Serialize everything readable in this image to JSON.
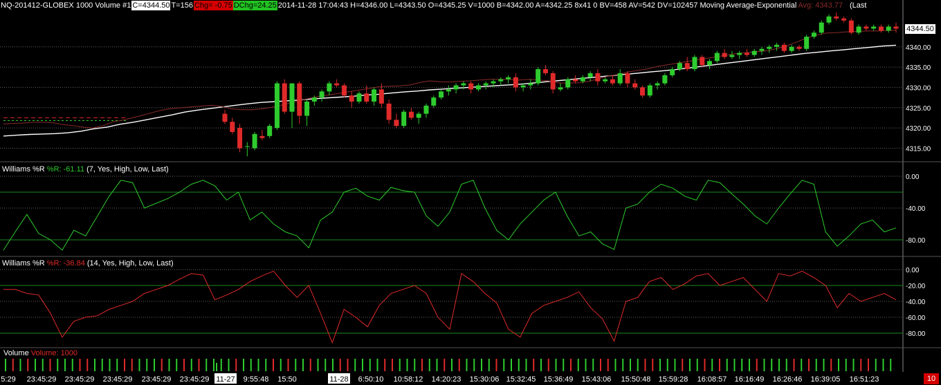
{
  "header": {
    "symbol": "NQ-201412-GLOBEX  1000 Volume  #1",
    "close": "C=4344.50",
    "trades": "T=156",
    "chg": "Chg= -0.75",
    "dchg": "DChg=24.25",
    "info": "2014-11-28 17:04:43 H=4346.00 L=4343.50 O=4345.25 V=1000 B=4342.00 A=4342.25 8x41 0 BV=458 AV=542 DV=102457 Moving Average-Exponential",
    "avg": "Avg: 4343.77",
    "last": "(Last"
  },
  "panels": {
    "wr7": {
      "name": "Williams %R",
      "value": "%R: -61.11",
      "params": "(7, Yes, High, Low, Last)"
    },
    "wr14": {
      "name": "Williams %R",
      "value": "%R: -36.84",
      "params": "(14, Yes, High, Low, Last)"
    },
    "volume": {
      "name": "Volume",
      "value": "Volume: 1000"
    }
  },
  "price_tag": "4344.50",
  "corner_badge": "10",
  "colors": {
    "up": "#2ecc2e",
    "down": "#e02a2a",
    "ma_slow": "#ffffff",
    "ma_fast": "#8a2b2b",
    "grid": "#666666"
  },
  "chart_data": [
    {
      "type": "candlestick",
      "title": "NQ-201412-GLOBEX 1000 Volume",
      "ylim": [
        4312,
        4349
      ],
      "y_ticks": [
        "4340.00",
        "4335.00",
        "4330.00",
        "4325.00",
        "4320.00",
        "4315.00"
      ],
      "x_labels": [
        "5:29",
        "23:45:29",
        "23:45:29",
        "23:45:29",
        "23:45:29",
        "23:45:29",
        "11-27",
        "9:55:48",
        "15:50",
        "11-28",
        "6:50:10",
        "10:58:12",
        "14:20:23",
        "15:30:06",
        "15:32:45",
        "15:36:49",
        "15:43:06",
        "15:50:48",
        "15:59:28",
        "16:08:57",
        "16:16:49",
        "16:26:46",
        "16:39:05",
        "16:51:23"
      ],
      "date_boxes": [
        "11-27",
        "11-28"
      ],
      "candles": [
        {
          "o": 4323.5,
          "h": 4324.5,
          "l": 4321.0,
          "c": 4321.5
        },
        {
          "o": 4321.5,
          "h": 4322.5,
          "l": 4318.5,
          "c": 4319.0
        },
        {
          "o": 4320.0,
          "h": 4321.0,
          "l": 4314.0,
          "c": 4315.0
        },
        {
          "o": 4315.5,
          "h": 4316.5,
          "l": 4313.0,
          "c": 4315.5
        },
        {
          "o": 4315.0,
          "h": 4319.0,
          "l": 4314.5,
          "c": 4318.5
        },
        {
          "o": 4318.0,
          "h": 4319.5,
          "l": 4317.0,
          "c": 4317.5
        },
        {
          "o": 4318.0,
          "h": 4321.0,
          "l": 4317.5,
          "c": 4320.5
        },
        {
          "o": 4320.0,
          "h": 4331.5,
          "l": 4319.5,
          "c": 4331.0
        },
        {
          "o": 4331.0,
          "h": 4332.0,
          "l": 4323.5,
          "c": 4324.0
        },
        {
          "o": 4324.0,
          "h": 4331.0,
          "l": 4320.0,
          "c": 4331.0
        },
        {
          "o": 4331.0,
          "h": 4331.5,
          "l": 4321.0,
          "c": 4323.0
        },
        {
          "o": 4323.0,
          "h": 4327.0,
          "l": 4320.5,
          "c": 4326.5
        },
        {
          "o": 4326.5,
          "h": 4328.0,
          "l": 4325.5,
          "c": 4327.5
        },
        {
          "o": 4327.5,
          "h": 4329.5,
          "l": 4326.5,
          "c": 4329.0
        },
        {
          "o": 4329.0,
          "h": 4331.5,
          "l": 4328.0,
          "c": 4331.0
        },
        {
          "o": 4331.0,
          "h": 4332.0,
          "l": 4330.0,
          "c": 4330.5
        },
        {
          "o": 4330.5,
          "h": 4331.0,
          "l": 4327.5,
          "c": 4328.0
        },
        {
          "o": 4328.0,
          "h": 4329.0,
          "l": 4325.0,
          "c": 4326.5
        },
        {
          "o": 4326.5,
          "h": 4329.0,
          "l": 4326.0,
          "c": 4328.5
        },
        {
          "o": 4328.5,
          "h": 4330.5,
          "l": 4326.0,
          "c": 4326.5
        },
        {
          "o": 4326.5,
          "h": 4330.0,
          "l": 4325.5,
          "c": 4329.5
        },
        {
          "o": 4329.5,
          "h": 4331.0,
          "l": 4325.0,
          "c": 4326.0
        },
        {
          "o": 4326.0,
          "h": 4327.0,
          "l": 4321.0,
          "c": 4322.0
        },
        {
          "o": 4322.0,
          "h": 4323.5,
          "l": 4320.0,
          "c": 4320.5
        },
        {
          "o": 4320.5,
          "h": 4324.5,
          "l": 4320.0,
          "c": 4324.0
        },
        {
          "o": 4324.0,
          "h": 4325.0,
          "l": 4322.0,
          "c": 4322.5
        },
        {
          "o": 4322.5,
          "h": 4324.0,
          "l": 4321.0,
          "c": 4323.5
        },
        {
          "o": 4323.5,
          "h": 4326.0,
          "l": 4322.5,
          "c": 4325.5
        },
        {
          "o": 4325.5,
          "h": 4328.0,
          "l": 4325.0,
          "c": 4327.5
        },
        {
          "o": 4327.5,
          "h": 4329.5,
          "l": 4327.0,
          "c": 4329.0
        },
        {
          "o": 4329.0,
          "h": 4330.5,
          "l": 4328.0,
          "c": 4329.5
        },
        {
          "o": 4329.5,
          "h": 4331.0,
          "l": 4328.5,
          "c": 4330.5
        },
        {
          "o": 4330.5,
          "h": 4331.5,
          "l": 4329.5,
          "c": 4331.0
        },
        {
          "o": 4331.0,
          "h": 4331.5,
          "l": 4328.5,
          "c": 4329.5
        },
        {
          "o": 4329.5,
          "h": 4331.0,
          "l": 4329.0,
          "c": 4330.5
        },
        {
          "o": 4330.5,
          "h": 4331.5,
          "l": 4329.5,
          "c": 4331.0
        },
        {
          "o": 4331.0,
          "h": 4332.0,
          "l": 4330.0,
          "c": 4331.5
        },
        {
          "o": 4331.5,
          "h": 4332.5,
          "l": 4330.5,
          "c": 4332.0
        },
        {
          "o": 4332.0,
          "h": 4333.0,
          "l": 4331.0,
          "c": 4332.5
        },
        {
          "o": 4332.5,
          "h": 4333.5,
          "l": 4329.0,
          "c": 4330.0
        },
        {
          "o": 4330.0,
          "h": 4331.0,
          "l": 4329.0,
          "c": 4330.5
        },
        {
          "o": 4330.5,
          "h": 4332.0,
          "l": 4329.5,
          "c": 4331.0
        },
        {
          "o": 4331.0,
          "h": 4335.0,
          "l": 4330.5,
          "c": 4334.5
        },
        {
          "o": 4334.5,
          "h": 4335.5,
          "l": 4333.0,
          "c": 4333.5
        },
        {
          "o": 4333.5,
          "h": 4334.0,
          "l": 4328.5,
          "c": 4329.5
        },
        {
          "o": 4329.5,
          "h": 4331.0,
          "l": 4329.0,
          "c": 4330.0
        },
        {
          "o": 4330.0,
          "h": 4332.5,
          "l": 4329.5,
          "c": 4332.0
        },
        {
          "o": 4332.0,
          "h": 4333.0,
          "l": 4331.0,
          "c": 4331.5
        },
        {
          "o": 4331.5,
          "h": 4333.0,
          "l": 4331.0,
          "c": 4332.5
        },
        {
          "o": 4332.5,
          "h": 4334.0,
          "l": 4331.5,
          "c": 4333.5
        },
        {
          "o": 4333.5,
          "h": 4334.5,
          "l": 4330.5,
          "c": 4331.5
        },
        {
          "o": 4331.5,
          "h": 4332.5,
          "l": 4331.0,
          "c": 4332.0
        },
        {
          "o": 4332.0,
          "h": 4333.0,
          "l": 4330.5,
          "c": 4331.0
        },
        {
          "o": 4331.0,
          "h": 4334.5,
          "l": 4330.5,
          "c": 4333.5
        },
        {
          "o": 4333.5,
          "h": 4334.0,
          "l": 4330.0,
          "c": 4331.0
        },
        {
          "o": 4331.0,
          "h": 4332.0,
          "l": 4329.5,
          "c": 4330.0
        },
        {
          "o": 4330.0,
          "h": 4330.5,
          "l": 4327.5,
          "c": 4328.0
        },
        {
          "o": 4328.0,
          "h": 4331.0,
          "l": 4327.5,
          "c": 4330.5
        },
        {
          "o": 4330.5,
          "h": 4331.5,
          "l": 4329.5,
          "c": 4331.0
        },
        {
          "o": 4331.0,
          "h": 4333.5,
          "l": 4330.5,
          "c": 4333.0
        },
        {
          "o": 4333.0,
          "h": 4335.0,
          "l": 4332.5,
          "c": 4334.5
        },
        {
          "o": 4334.5,
          "h": 4336.5,
          "l": 4334.0,
          "c": 4336.0
        },
        {
          "o": 4336.0,
          "h": 4337.5,
          "l": 4334.0,
          "c": 4334.5
        },
        {
          "o": 4334.5,
          "h": 4338.0,
          "l": 4334.0,
          "c": 4337.5
        },
        {
          "o": 4337.5,
          "h": 4338.0,
          "l": 4335.0,
          "c": 4335.5
        },
        {
          "o": 4335.5,
          "h": 4337.0,
          "l": 4334.5,
          "c": 4336.5
        },
        {
          "o": 4336.5,
          "h": 4339.0,
          "l": 4336.0,
          "c": 4338.5
        },
        {
          "o": 4338.5,
          "h": 4339.5,
          "l": 4337.0,
          "c": 4337.5
        },
        {
          "o": 4337.5,
          "h": 4339.0,
          "l": 4337.0,
          "c": 4338.0
        },
        {
          "o": 4338.0,
          "h": 4339.0,
          "l": 4337.0,
          "c": 4338.5
        },
        {
          "o": 4338.5,
          "h": 4339.5,
          "l": 4337.5,
          "c": 4338.0
        },
        {
          "o": 4338.0,
          "h": 4339.5,
          "l": 4337.5,
          "c": 4339.0
        },
        {
          "o": 4339.0,
          "h": 4340.0,
          "l": 4338.0,
          "c": 4339.5
        },
        {
          "o": 4339.5,
          "h": 4340.5,
          "l": 4338.5,
          "c": 4340.0
        },
        {
          "o": 4340.0,
          "h": 4341.0,
          "l": 4339.0,
          "c": 4340.5
        },
        {
          "o": 4340.5,
          "h": 4341.0,
          "l": 4338.5,
          "c": 4339.0
        },
        {
          "o": 4339.0,
          "h": 4340.5,
          "l": 4338.5,
          "c": 4340.0
        },
        {
          "o": 4340.0,
          "h": 4340.5,
          "l": 4339.0,
          "c": 4339.5
        },
        {
          "o": 4339.5,
          "h": 4343.0,
          "l": 4339.0,
          "c": 4342.5
        },
        {
          "o": 4342.5,
          "h": 4344.0,
          "l": 4342.0,
          "c": 4343.5
        },
        {
          "o": 4343.5,
          "h": 4346.5,
          "l": 4343.0,
          "c": 4346.0
        },
        {
          "o": 4346.0,
          "h": 4348.0,
          "l": 4345.5,
          "c": 4347.5
        },
        {
          "o": 4347.5,
          "h": 4348.5,
          "l": 4346.5,
          "c": 4347.0
        },
        {
          "o": 4347.0,
          "h": 4347.5,
          "l": 4346.0,
          "c": 4346.5
        },
        {
          "o": 4346.5,
          "h": 4347.0,
          "l": 4343.0,
          "c": 4343.5
        },
        {
          "o": 4343.5,
          "h": 4345.5,
          "l": 4343.0,
          "c": 4345.0
        },
        {
          "o": 4345.0,
          "h": 4345.5,
          "l": 4344.0,
          "c": 4344.5
        },
        {
          "o": 4344.5,
          "h": 4345.5,
          "l": 4344.0,
          "c": 4345.0
        },
        {
          "o": 4345.0,
          "h": 4345.5,
          "l": 4343.5,
          "c": 4344.0
        },
        {
          "o": 4344.0,
          "h": 4345.5,
          "l": 4343.5,
          "c": 4345.0
        },
        {
          "o": 4345.0,
          "h": 4346.0,
          "l": 4343.5,
          "c": 4344.5
        }
      ],
      "ma_slow": [
        4318.0,
        4318.2,
        4318.4,
        4318.5,
        4318.6,
        4318.8,
        4319.2,
        4319.8,
        4320.2,
        4320.9,
        4321.4,
        4322.0,
        4322.6,
        4323.2,
        4323.9,
        4324.4,
        4324.8,
        4325.2,
        4325.6,
        4326.0,
        4326.3,
        4326.5,
        4326.7,
        4326.9,
        4327.2,
        4327.4,
        4327.6,
        4327.8,
        4328.1,
        4328.3,
        4328.6,
        4328.9,
        4329.1,
        4329.4,
        4329.6,
        4329.8,
        4330.0,
        4330.2,
        4330.4,
        4330.6,
        4330.8,
        4331.1,
        4331.4,
        4331.7,
        4332.0,
        4332.3,
        4332.6,
        4332.9,
        4333.2,
        4333.5,
        4333.8,
        4334.1,
        4334.4,
        4334.8,
        4335.2,
        4335.6,
        4336.0,
        4336.4,
        4336.8,
        4337.2,
        4337.6,
        4338.0,
        4338.4,
        4338.7,
        4339.0,
        4339.3,
        4339.6,
        4339.9,
        4340.2,
        4340.4
      ],
      "ma_fast": [
        4321.0,
        4321.1,
        4321.2,
        4321.4,
        4321.4,
        4321.3,
        4320.8,
        4320.6,
        4320.2,
        4320.0,
        4320.5,
        4321.5,
        4321.9,
        4322.5,
        4323.1,
        4323.8,
        4324.4,
        4324.8,
        4325.0,
        4325.2,
        4325.4,
        4325.6,
        4325.3,
        4324.7,
        4324.5,
        4324.5,
        4324.7,
        4325.1,
        4325.6,
        4326.2,
        4326.8,
        4327.4,
        4327.9,
        4328.2,
        4328.6,
        4329.0,
        4329.4,
        4329.8,
        4330.2,
        4330.3,
        4330.4,
        4330.6,
        4331.2,
        4331.6,
        4331.4,
        4331.3,
        4331.5,
        4331.6,
        4331.8,
        4332.0,
        4332.0,
        4332.0,
        4331.8,
        4332.0,
        4331.8,
        4331.6,
        4331.1,
        4331.1,
        4331.1,
        4331.5,
        4332.1,
        4332.8,
        4333.2,
        4333.8,
        4334.2,
        4334.6,
        4335.2,
        4335.6,
        4336.0,
        4336.4,
        4336.8,
        4337.2,
        4337.6,
        4338.0,
        4338.4,
        4338.6,
        4338.8,
        4339.0,
        4339.6,
        4340.3,
        4341.2,
        4342.2,
        4342.9,
        4343.4,
        4343.5,
        4343.7,
        4343.8,
        4343.9,
        4343.9,
        4344.0,
        4344.1
      ]
    },
    {
      "type": "line",
      "title": "Williams %R (7, Yes, High, Low, Last)",
      "ylim": [
        -100,
        0
      ],
      "y_ticks": [
        "0.00",
        "-40.00",
        "-80.00"
      ],
      "values": [
        -93,
        -70,
        -48,
        -72,
        -80,
        -93,
        -68,
        -75,
        -50,
        -25,
        -5,
        -8,
        -40,
        -34,
        -28,
        -20,
        -10,
        -5,
        -12,
        -30,
        -20,
        -55,
        -45,
        -60,
        -70,
        -75,
        -90,
        -55,
        -45,
        -20,
        -15,
        -25,
        -30,
        -14,
        -18,
        -20,
        -50,
        -63,
        -45,
        -10,
        -5,
        -40,
        -68,
        -80,
        -60,
        -45,
        -30,
        -20,
        -50,
        -75,
        -70,
        -85,
        -92,
        -40,
        -35,
        -20,
        -10,
        -15,
        -25,
        -30,
        -5,
        -8,
        -22,
        -35,
        -50,
        -60,
        -40,
        -22,
        -5,
        -10,
        -70,
        -88,
        -75,
        -60,
        -55,
        -70,
        -65
      ],
      "overbought": -20,
      "oversold": -80
    },
    {
      "type": "line",
      "title": "Williams %R (14, Yes, High, Low, Last)",
      "ylim": [
        -100,
        0
      ],
      "y_ticks": [
        "0.00",
        "-20.00",
        "-40.00",
        "-60.00",
        "-80.00"
      ],
      "values": [
        -25,
        -25,
        -30,
        -32,
        -55,
        -85,
        -65,
        -60,
        -58,
        -50,
        -45,
        -40,
        -30,
        -25,
        -20,
        -12,
        -5,
        -7,
        -38,
        -32,
        -25,
        -15,
        -8,
        -2,
        -20,
        -35,
        -20,
        -55,
        -92,
        -50,
        -60,
        -72,
        -45,
        -30,
        -25,
        -20,
        -30,
        -60,
        -75,
        -5,
        -15,
        -30,
        -42,
        -75,
        -85,
        -55,
        -45,
        -40,
        -35,
        -28,
        -48,
        -62,
        -90,
        -40,
        -35,
        -15,
        -10,
        -25,
        -18,
        -8,
        -5,
        -20,
        -15,
        -10,
        -25,
        -40,
        -5,
        -8,
        -2,
        -10,
        -20,
        -48,
        -30,
        -40,
        -35,
        -30,
        -38
      ],
      "overbought": -20,
      "oversold": -80
    },
    {
      "type": "bar",
      "title": "Volume",
      "values": "1000 per bar (constant volume bars)"
    }
  ]
}
